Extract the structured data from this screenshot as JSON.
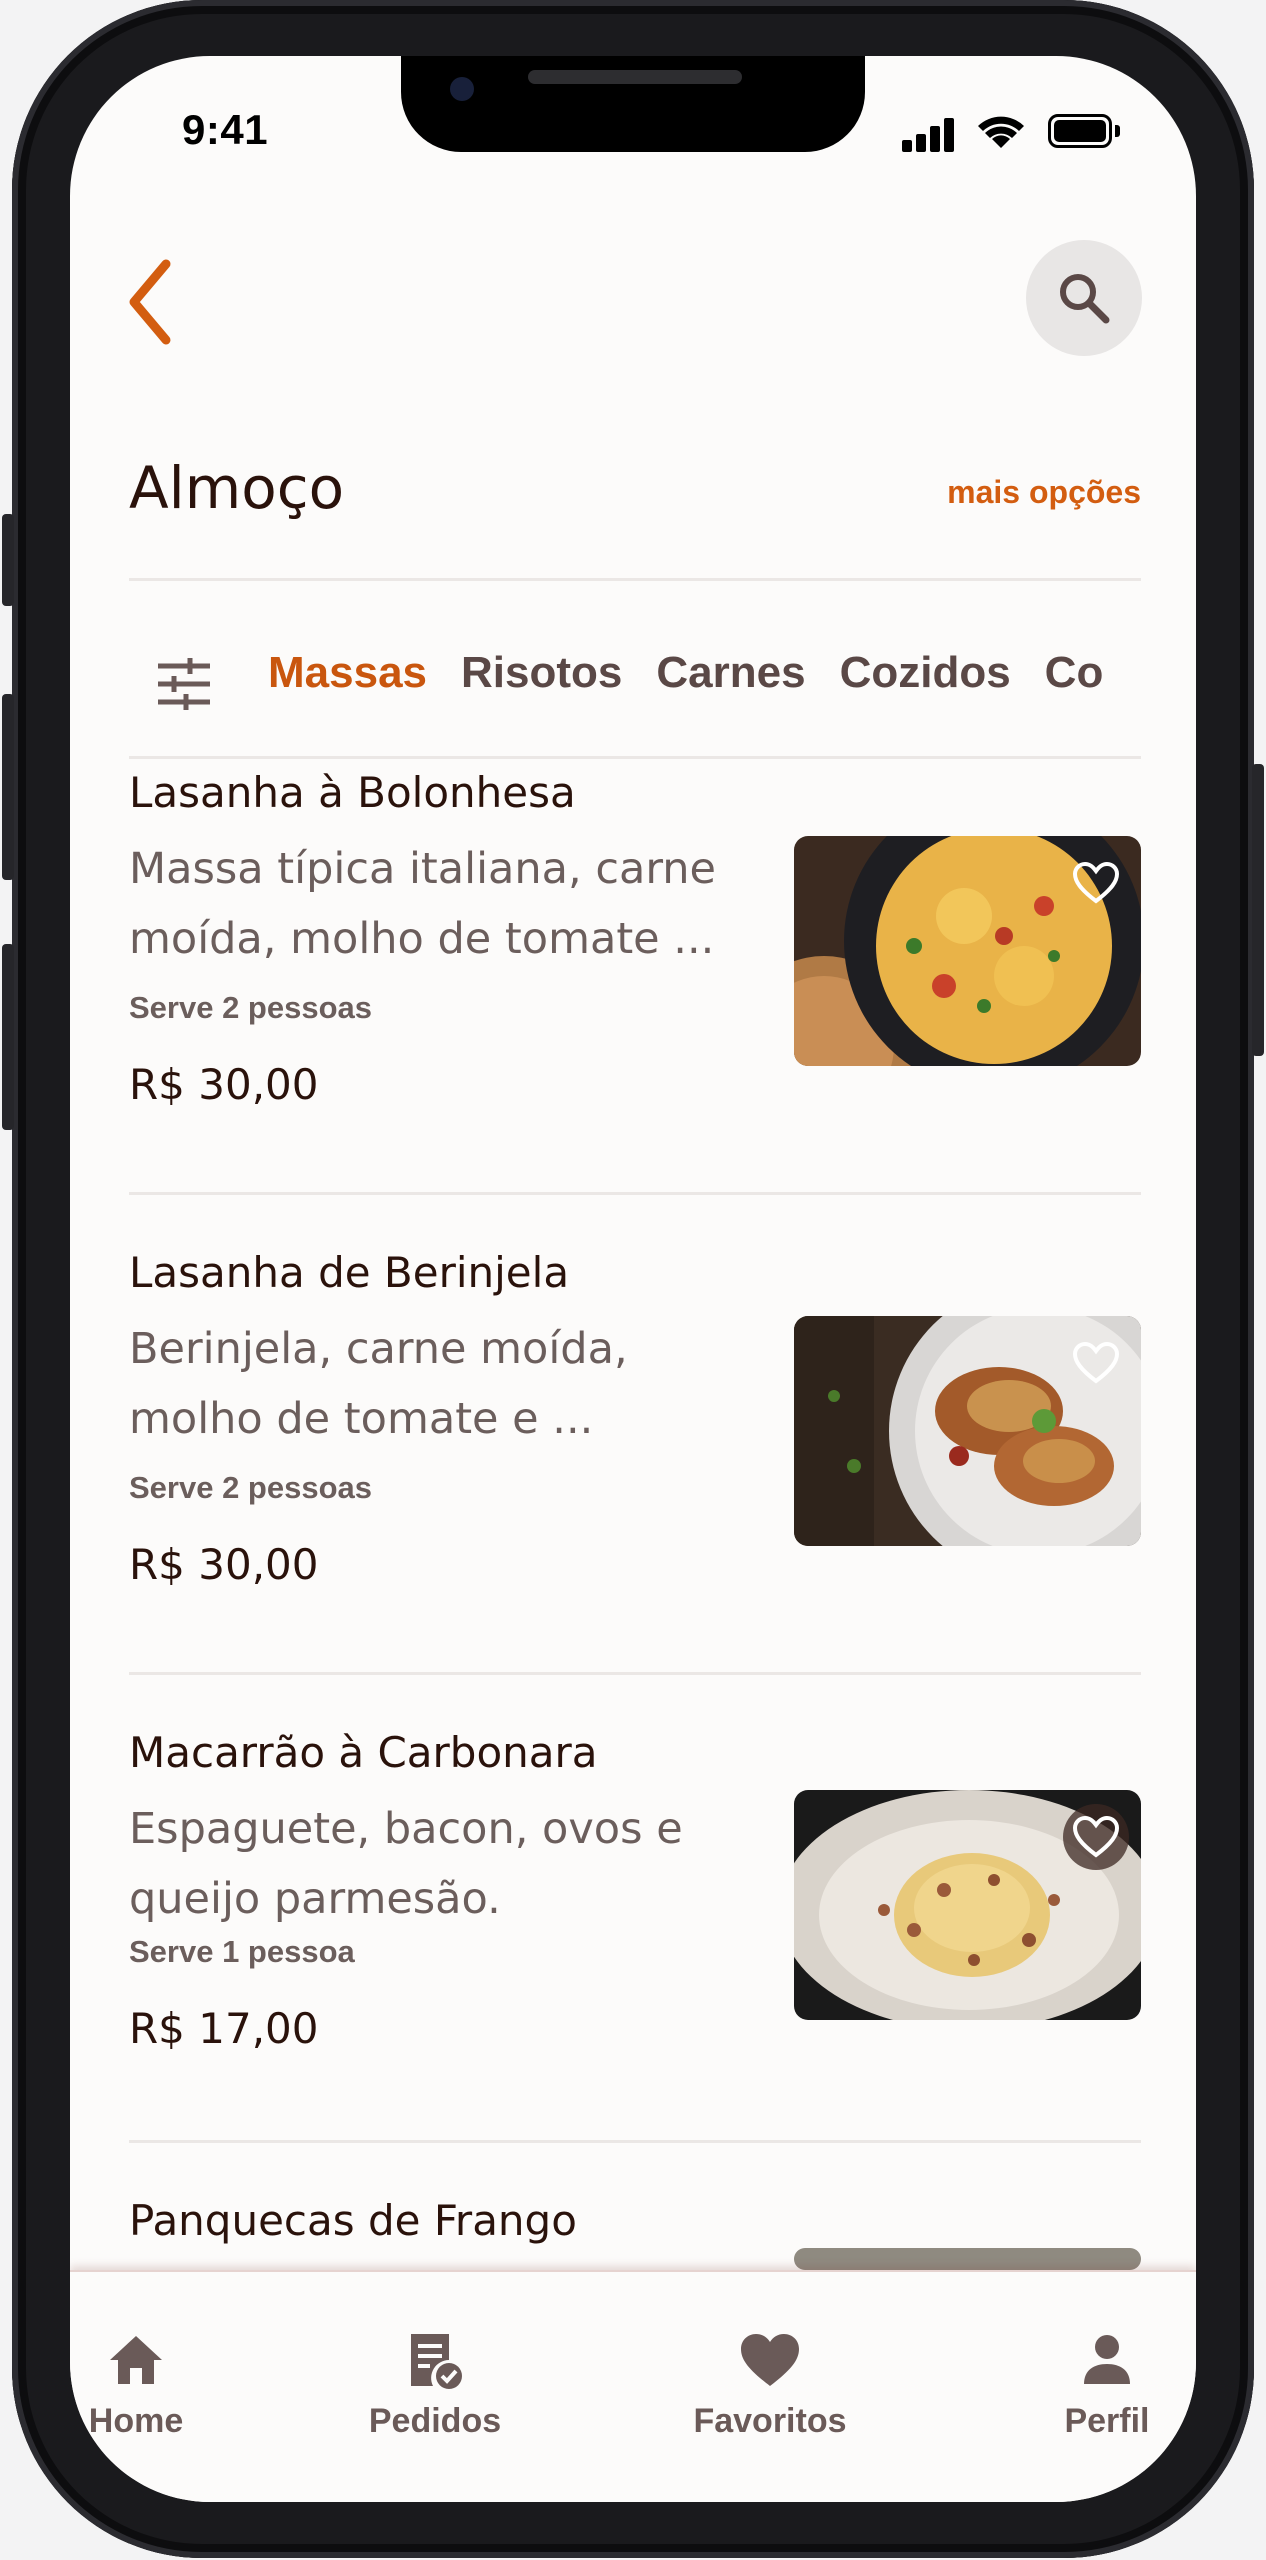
{
  "status_bar": {
    "time": "9:41"
  },
  "header": {
    "title": "Almoço",
    "more_link": "mais opções"
  },
  "tabs": [
    {
      "label": "Massas",
      "active": true
    },
    {
      "label": "Risotos",
      "active": false
    },
    {
      "label": "Carnes",
      "active": false
    },
    {
      "label": "Cozidos",
      "active": false
    },
    {
      "label": "Co",
      "active": false
    }
  ],
  "menu": [
    {
      "name": "Lasanha à Bolonhesa",
      "description": "Massa típica italiana, carne moída, molho de tomate ...",
      "serves": "Serve 2 pessoas",
      "price": "R$ 30,00",
      "photo_icon": "lasagna-photo-icon"
    },
    {
      "name": "Lasanha de Berinjela",
      "description": "Berinjela, carne moída, molho de tomate e ...",
      "serves": "Serve 2 pessoas",
      "price": "R$ 30,00",
      "photo_icon": "eggplant-lasagna-photo-icon"
    },
    {
      "name": "Macarrão à Carbonara",
      "description": "Espaguete, bacon, ovos e queijo parmesão.",
      "serves": "Serve 1 pessoa",
      "price": "R$ 17,00",
      "photo_icon": "carbonara-photo-icon"
    },
    {
      "name": "Panquecas de Frango",
      "description": "",
      "serves": "",
      "price": "",
      "photo_icon": "pancake-photo-icon"
    }
  ],
  "bottom_nav": [
    {
      "label": "Home",
      "icon": "home-icon"
    },
    {
      "label": "Pedidos",
      "icon": "orders-icon"
    },
    {
      "label": "Favoritos",
      "icon": "heart-icon"
    },
    {
      "label": "Perfil",
      "icon": "user-icon"
    }
  ],
  "colors": {
    "accent": "#d35d10",
    "text_dark": "#2a120b",
    "text_muted": "#6b5e5c",
    "background": "#fcfbfa"
  }
}
